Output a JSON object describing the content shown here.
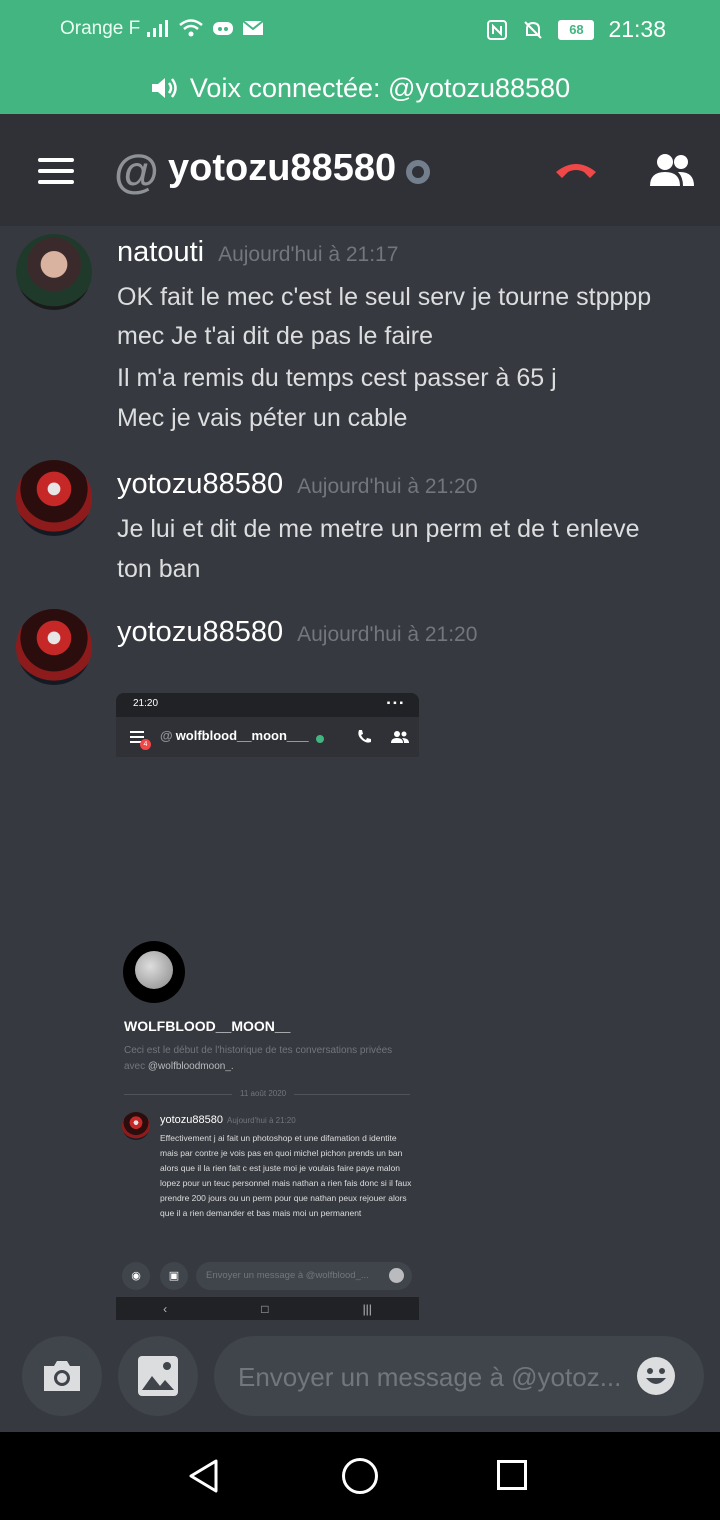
{
  "status_bar": {
    "carrier": "Orange F",
    "battery": "68",
    "time": "21:38"
  },
  "voice_bar": {
    "label": "Voix connectée: @yotozu88580"
  },
  "header": {
    "at_symbol": "@",
    "title": "yotozu88580"
  },
  "messages": [
    {
      "author": "natouti",
      "timestamp": "Aujourd'hui à 21:17",
      "lines": [
        "OK fait le mec c'est le seul serv je tourne stpppp",
        "mec Je t'ai dit de pas le faire",
        "Il m'a remis du temps cest passer à 65 j",
        "Mec je vais péter un cable"
      ]
    },
    {
      "author": "yotozu88580",
      "timestamp": "Aujourd'hui à 21:20",
      "lines": [
        "Je lui et dit de me metre un perm et de t enleve",
        "ton ban"
      ]
    },
    {
      "author": "yotozu88580",
      "timestamp": "Aujourd'hui à 21:20"
    }
  ],
  "attachment": {
    "status_time": "21:20",
    "badge": "4",
    "title": "wolfblood__moon___",
    "profile_name": "WOLFBLOOD__MOON__",
    "intro": "Ceci est le début de l'historique de tes conversations privées avec ",
    "intro_handle": "@wolfbloodmoon_.",
    "date_divider": "11 août 2020",
    "author": "yotozu88580",
    "timestamp": "Aujourd'hui à 21:20",
    "body": "Effectivement j ai fait un photoshop et une difamation d identite mais par contre je vois pas en quoi michel pichon prends un ban alors que il la rien fait c est juste moi je voulais faire paye malon lopez pour un teuc personnel mais nathan a rien fais donc si il faux prendre 200 jours ou un perm pour que nathan peux rejouer alors que il a rien demander et bas mais moi un permanent",
    "input_placeholder": "Envoyer un message à @wolfblood_..."
  },
  "composer": {
    "placeholder": "Envoyer un message à @yotoz..."
  },
  "icons": {
    "accent": "#43b581",
    "hangup": "#f04747"
  }
}
